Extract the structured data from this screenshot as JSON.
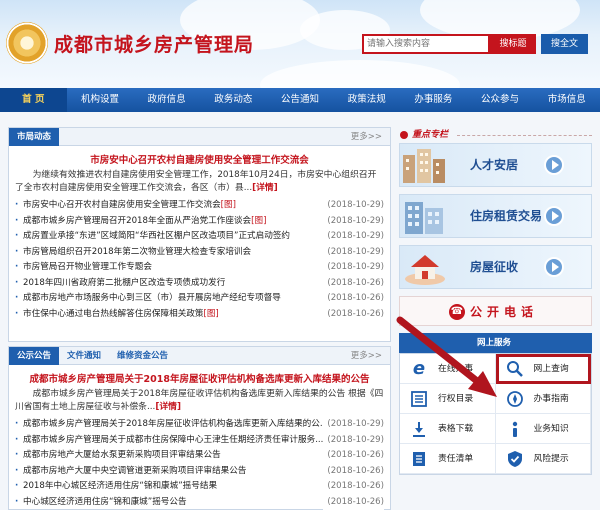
{
  "header": {
    "site_title": "成都市城乡房产管理局",
    "search_placeholder": "请输入搜索内容",
    "search_title_label": "搜标题",
    "search_all_label": "搜全文"
  },
  "nav": [
    "首 页",
    "机构设置",
    "政府信息",
    "政务动态",
    "公告通知",
    "政策法规",
    "办事服务",
    "公众参与",
    "市场信息"
  ],
  "news": {
    "tab": "市局动态",
    "more": "更多>>",
    "headline": "市房安中心召开农村自建房使用安全管理工作交流会",
    "summary": "为继续有效推进农村自建房使用安全管理工作，2018年10月24日，市房安中心组织召开了全市农村自建房使用安全管理工作交流会，各区（市）县...",
    "detail": "[详情]",
    "items": [
      {
        "title": "市房安中心召开农村自建房使用安全管理工作交流会",
        "tag": "[图]",
        "date": "(2018-10-29)"
      },
      {
        "title": "成都市城乡房产管理局召开2018年全面从严治党工作座谈会",
        "tag": "[图]",
        "date": "(2018-10-29)"
      },
      {
        "title": "成房置业承接“东进”区域简阳“华西社区棚户区改造项目”正式启动签约",
        "tag": "",
        "date": "(2018-10-29)"
      },
      {
        "title": "市房管局组织召开2018年第二次物业管理大检查专家培训会",
        "tag": "",
        "date": "(2018-10-29)"
      },
      {
        "title": "市房管局召开物业管理工作专题会",
        "tag": "",
        "date": "(2018-10-29)"
      },
      {
        "title": "2018年四川省政府第二批棚户区改造专项债成功发行",
        "tag": "",
        "date": "(2018-10-26)"
      },
      {
        "title": "成都市房地产市场服务中心到三区（市）县开展房地产经纪专项督导",
        "tag": "",
        "date": "(2018-10-26)"
      },
      {
        "title": "市住保中心通过电台热线解答住房保障相关政策",
        "tag": "[图]",
        "date": "(2018-10-26)"
      }
    ]
  },
  "notice": {
    "tabs": [
      "公示公告",
      "文件通知",
      "维修资金公告"
    ],
    "more": "更多>>",
    "headline": "成都市城乡房产管理局关于2018年房屋征收评估机构备选库更新入库结果的公告",
    "summary": "成都市城乡房产管理局关于2018年房屋征收评估机构备选库更新入库结果的公告 根据《四川省国有土地上房屋征收与补偿条...",
    "detail": "[详情]",
    "items": [
      {
        "title": "成都市城乡房产管理局关于2018年房屋征收评估机构备选库更新入库结果的公...",
        "date": "(2018-10-29)"
      },
      {
        "title": "成都市城乡房产管理局关于成都市住房保障中心王津生任期经济责任审计服务...",
        "date": "(2018-10-29)"
      },
      {
        "title": "成都市房地产大厦给水泵更新采购项目评审结果公告",
        "date": "(2018-10-26)"
      },
      {
        "title": "成都市房地产大厦中央空调管道更新采购项目评审结果公告",
        "date": "(2018-10-26)"
      },
      {
        "title": "2018年中心城区经济适用住房“锦和康城”摇号结果",
        "date": "(2018-10-26)"
      },
      {
        "title": "中心城区经济适用住房“锦和康城”摇号公告",
        "date": "(2018-10-26)"
      }
    ]
  },
  "special": {
    "title": "重点专栏",
    "banners": [
      "人才安居",
      "住房租赁交易",
      "房屋征收"
    ],
    "phone": "公开电话"
  },
  "service": {
    "title": "网上服务",
    "items": [
      {
        "label": "在线办事",
        "icon": "e-icon"
      },
      {
        "label": "网上查询",
        "icon": "search-icon"
      },
      {
        "label": "行权目录",
        "icon": "list-icon"
      },
      {
        "label": "办事指南",
        "icon": "compass-icon"
      },
      {
        "label": "表格下载",
        "icon": "download-icon"
      },
      {
        "label": "业务知识",
        "icon": "info-icon"
      },
      {
        "label": "责任清单",
        "icon": "document-icon"
      },
      {
        "label": "风险提示",
        "icon": "shield-icon"
      }
    ]
  }
}
